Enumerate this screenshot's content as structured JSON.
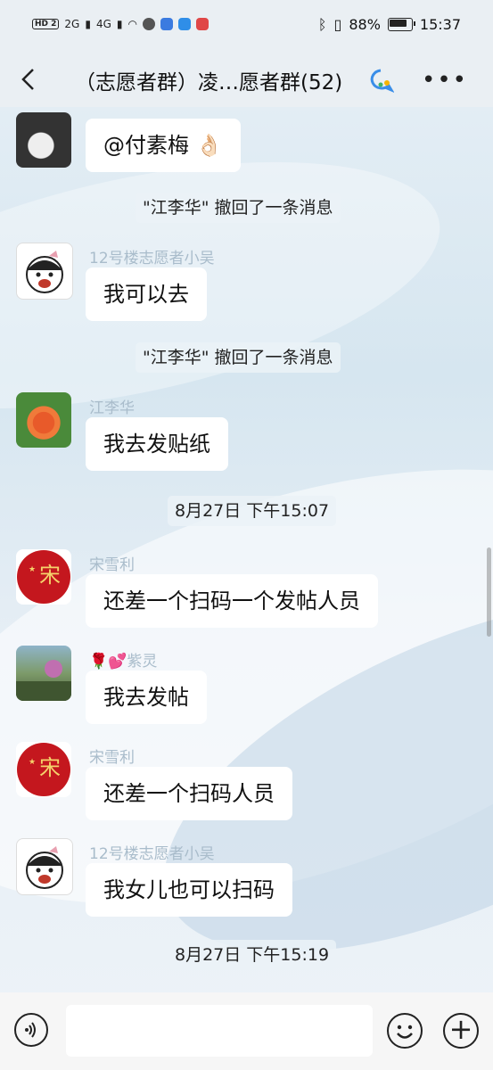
{
  "status_bar": {
    "left_indicators": [
      "HD 2",
      "2G",
      "4G"
    ],
    "battery": "88%",
    "time": "15:37"
  },
  "header": {
    "back_icon": "chevron-left-icon",
    "title": "（志愿者群）凌…愿者群(52)",
    "more_icon": "more-dots-icon"
  },
  "messages": [
    {
      "type": "chat",
      "sender": "",
      "avatar": "moon-avatar",
      "text": "@付素梅 👌🏻"
    },
    {
      "type": "system",
      "text": "\"江李华\" 撤回了一条消息"
    },
    {
      "type": "chat",
      "sender": "12号楼志愿者小吴",
      "avatar": "girl-avatar",
      "text": "我可以去"
    },
    {
      "type": "system",
      "text": "\"江李华\" 撤回了一条消息"
    },
    {
      "type": "chat",
      "sender": "江李华",
      "avatar": "flower-avatar",
      "text": "我去发贴纸"
    },
    {
      "type": "time",
      "text": "8月27日 下午15:07"
    },
    {
      "type": "chat",
      "sender": "宋雪利",
      "avatar": "song-avatar",
      "text": "还差一个扫码一个发帖人员"
    },
    {
      "type": "chat",
      "sender": "🌹💕紫灵",
      "avatar": "rose-avatar",
      "text": "我去发帖"
    },
    {
      "type": "chat",
      "sender": "宋雪利",
      "avatar": "song-avatar",
      "text": "还差一个扫码人员"
    },
    {
      "type": "chat",
      "sender": "12号楼志愿者小吴",
      "avatar": "girl-avatar",
      "text": "我女儿也可以扫码"
    },
    {
      "type": "time",
      "text": "8月27日 下午15:19"
    }
  ],
  "input_bar": {
    "voice_icon": "voice-icon",
    "text_value": "",
    "emoji_icon": "emoji-icon",
    "plus_icon": "plus-icon"
  }
}
